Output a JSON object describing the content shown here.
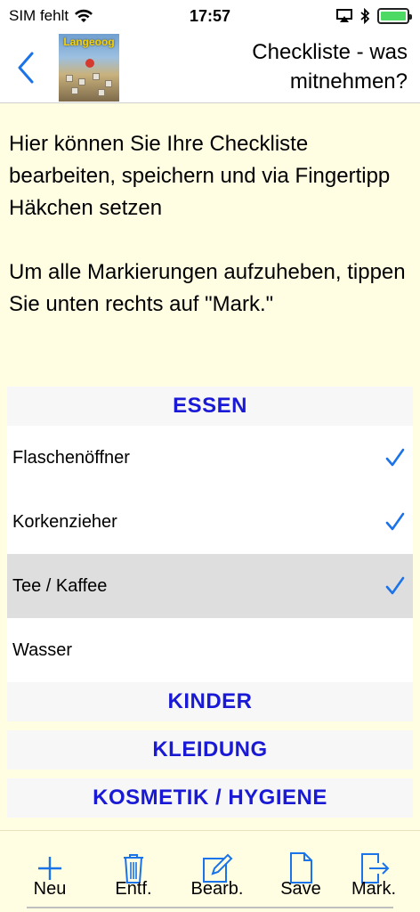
{
  "status": {
    "carrier": "SIM fehlt",
    "time": "17:57"
  },
  "nav": {
    "logo_text": "Langeoog",
    "title": "Checkliste - was mitnehmen?"
  },
  "intro": {
    "paragraph1": "Hier können Sie Ihre Checkliste bearbeiten, speichern und via Fingertipp Häkchen setzen",
    "paragraph2": "Um alle Markierungen aufzuheben, tippen Sie unten rechts auf \"Mark.\""
  },
  "list": {
    "sections": [
      {
        "title": "ESSEN",
        "items": [
          {
            "label": "Flaschenöffner",
            "checked": true
          },
          {
            "label": "Korkenzieher",
            "checked": true
          },
          {
            "label": "Tee / Kaffee",
            "checked": true,
            "selected": true
          },
          {
            "label": "Wasser",
            "checked": false
          }
        ]
      },
      {
        "title": "KINDER"
      },
      {
        "title": "KLEIDUNG"
      },
      {
        "title": "KOSMETIK / HYGIENE"
      }
    ]
  },
  "toolbar": {
    "new_label": "Neu",
    "delete_label": "Entf.",
    "edit_label": "Bearb.",
    "save_label": "Save",
    "mark_label": "Mark."
  },
  "colors": {
    "accent": "#1a73e8",
    "section_title": "#1a1ad6",
    "background": "#fffde2",
    "battery": "#4cd964"
  },
  "icons": [
    "wifi-icon",
    "airplay-icon",
    "bluetooth-icon",
    "battery-icon",
    "back-chevron-icon",
    "checkmark-icon",
    "plus-icon",
    "trash-icon",
    "edit-icon",
    "document-icon",
    "export-icon"
  ]
}
